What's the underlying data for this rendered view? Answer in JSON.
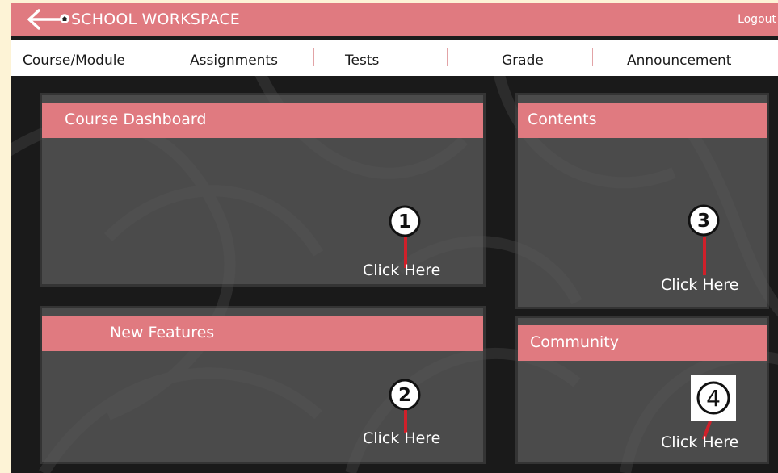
{
  "header": {
    "title": "SCHOOL WORKSPACE",
    "logout_label": "Logout",
    "back_icon": "back-arrow-icon",
    "home_icon": "home-icon"
  },
  "nav": {
    "items": [
      {
        "label": "Course/Module"
      },
      {
        "label": "Assignments"
      },
      {
        "label": "Tests"
      },
      {
        "label": "Grade"
      },
      {
        "label": "Announcement"
      }
    ]
  },
  "panels": {
    "course_dashboard": {
      "title": "Course Dashboard",
      "marker": "1",
      "action_label": "Click Here"
    },
    "new_features": {
      "title": "New Features",
      "marker": "2",
      "action_label": "Click Here"
    },
    "contents": {
      "title": "Contents",
      "marker": "3",
      "action_label": "Click Here"
    },
    "community": {
      "title": "Community",
      "marker": "4",
      "action_label": "Click Here"
    }
  },
  "colors": {
    "accent": "#e07a80",
    "page_background": "#fdf3d6",
    "workspace_background": "#1c1c1c",
    "panel_fill": "#5a5a5a",
    "marker_line": "#d0202a"
  }
}
